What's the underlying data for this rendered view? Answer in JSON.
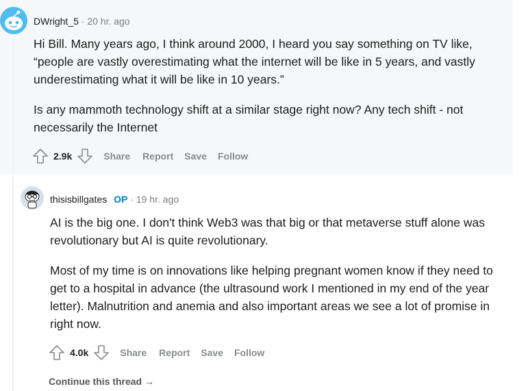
{
  "comment1": {
    "author": "DWright_5",
    "separator": "·",
    "time": "20 hr. ago",
    "paragraphs": [
      "Hi Bill. Many years ago, I think around 2000, I heard you say something on TV like, “people are vastly overestimating what the internet will be like in 5 years, and vastly underestimating what it will be like in 10 years.”",
      "Is any mammoth technology shift at a similar stage right now? Any tech shift - not necessarily the Internet"
    ],
    "score": "2.9k",
    "actions": {
      "share": "Share",
      "report": "Report",
      "save": "Save",
      "follow": "Follow"
    }
  },
  "comment2": {
    "author": "thisisbillgates",
    "op_badge": "OP",
    "separator": "·",
    "time": "19 hr. ago",
    "paragraphs": [
      "AI is the big one. I don't think Web3 was that big or that metaverse stuff alone was revolutionary but AI is quite revolutionary.",
      "Most of my time is on innovations like helping pregnant women know if they need to get to a hospital in advance (the ultrasound work I mentioned in my end of the year letter). Malnutrition and anemia and also important areas we see a lot of promise in right now."
    ],
    "score": "4.0k",
    "actions": {
      "share": "Share",
      "report": "Report",
      "save": "Save",
      "follow": "Follow"
    }
  },
  "continue_thread": "Continue this thread",
  "colors": {
    "op": "#0079d3",
    "meta": "#7c7c7c",
    "action": "#878a8c",
    "highlight_bg": "#f6f7f8",
    "avatar1_bg": "#4fbcf0"
  }
}
